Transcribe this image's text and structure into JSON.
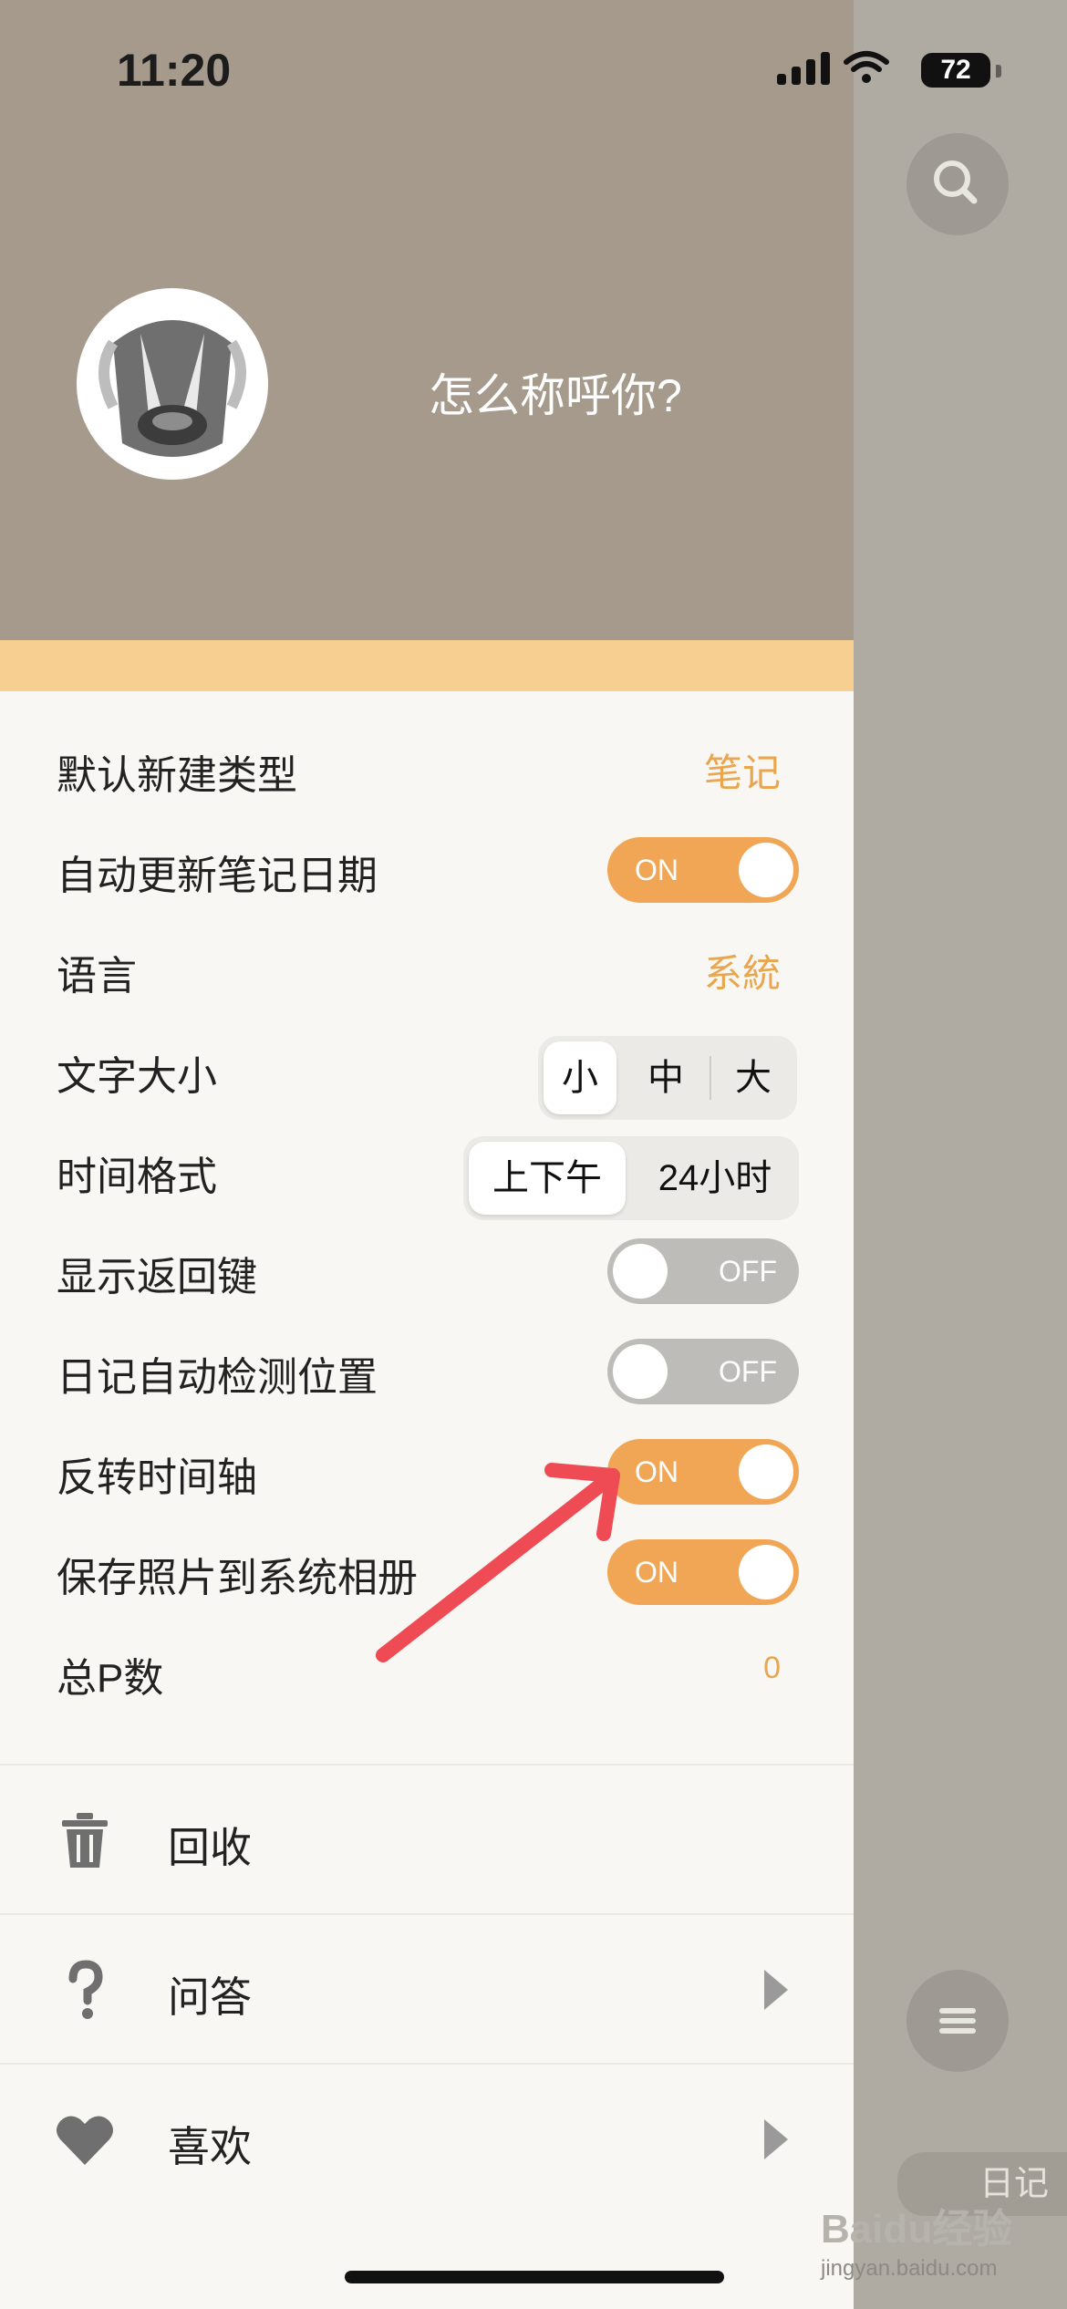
{
  "status_bar": {
    "time": "11:20",
    "battery": "72"
  },
  "header": {
    "nickname_prompt": "怎么称呼你?"
  },
  "settings": [
    {
      "label": "默认新建类型",
      "value": "笔记"
    },
    {
      "label": "自动更新笔记日期",
      "toggle": "ON"
    },
    {
      "label": "语言",
      "value": "系統"
    },
    {
      "label": "文字大小",
      "options": [
        "小",
        "中",
        "大"
      ],
      "selected": "小"
    },
    {
      "label": "时间格式",
      "options": [
        "上下午",
        "24小时"
      ],
      "selected": "上下午"
    },
    {
      "label": "显示返回键",
      "toggle": "OFF"
    },
    {
      "label": "日记自动检测位置",
      "toggle": "OFF"
    },
    {
      "label": "反转时间轴",
      "toggle": "ON"
    },
    {
      "label": "保存照片到系统相册",
      "toggle": "ON"
    },
    {
      "label": "总P数",
      "value": "0"
    }
  ],
  "menu": [
    {
      "label": "回收",
      "icon": "trash-icon"
    },
    {
      "label": "问答",
      "icon": "question-icon"
    },
    {
      "label": "喜欢",
      "icon": "heart-icon"
    }
  ],
  "side": {
    "diary_tab": "日记"
  },
  "watermark": {
    "brand": "Baidu经验",
    "url": "jingyan.baidu.com"
  },
  "colors": {
    "accent": "#f0a655",
    "header": "#a69a8c",
    "off_toggle": "#bdbcb8"
  }
}
